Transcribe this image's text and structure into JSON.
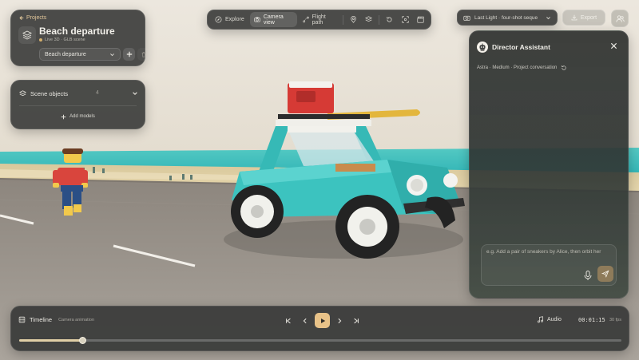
{
  "project": {
    "back_label": "Projects",
    "title": "Beach departure",
    "subtitle": "Live 3D · GLB scene",
    "scene_select": "Beach departure"
  },
  "scene_objects": {
    "label": "Scene objects",
    "count": "4",
    "add_models": "Add models"
  },
  "toolbar": {
    "explore": "Explore",
    "camera_view": "Camera view",
    "flight_path": "Flight path",
    "active": "camera_view"
  },
  "shot": {
    "label": "Last Light · four-shot seque"
  },
  "export_label": "Export",
  "assistant": {
    "title": "Director Assistant",
    "meta": "Astra · Medium · Project conversation",
    "placeholder": "e.g. Add a pair of sneakers by Alice, then orbit her"
  },
  "timeline": {
    "title": "Timeline",
    "subtitle": "Camera animation",
    "audio_label": "Audio",
    "time": "00:01:15",
    "fps": "30 fps",
    "progress": 0.105
  },
  "colors": {
    "accent": "#e8c288",
    "panel": "#343634",
    "sea": "#45c3c0",
    "car": "#3cc3bf",
    "cooler": "#d63a35"
  },
  "icons": {
    "back": "arrow-left-icon",
    "scene": "cube-stack-icon",
    "layers": "layers-icon",
    "compass": "compass-icon",
    "camera": "camera-icon",
    "path": "flight-path-icon",
    "pin": "map-pin-icon",
    "reset": "reset-icon",
    "focus": "focus-icon",
    "clapper": "clapperboard-icon",
    "export": "download-icon",
    "users": "users-icon",
    "close": "close-icon",
    "mic": "microphone-icon",
    "send": "send-icon",
    "audio": "music-note-icon"
  }
}
